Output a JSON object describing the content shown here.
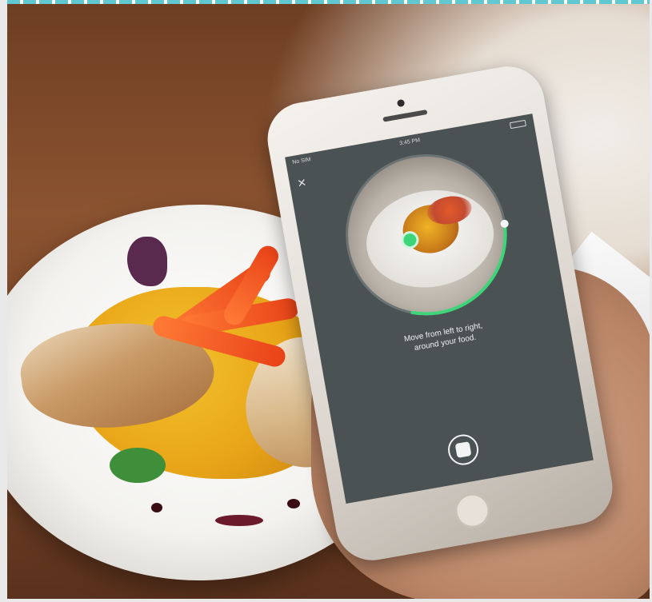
{
  "phone_ui": {
    "status_carrier": "No SIM",
    "status_time": "3:45 PM",
    "close_glyph": "×",
    "instruction_line1": "Move from left to right,",
    "instruction_line2": "around your food.",
    "progress_fraction": 0.3,
    "accent_color": "#3ed57a",
    "screen_color": "#4b5253"
  },
  "icons": {
    "close": "close-icon",
    "shutter": "capture-button-icon",
    "battery": "battery-icon"
  }
}
